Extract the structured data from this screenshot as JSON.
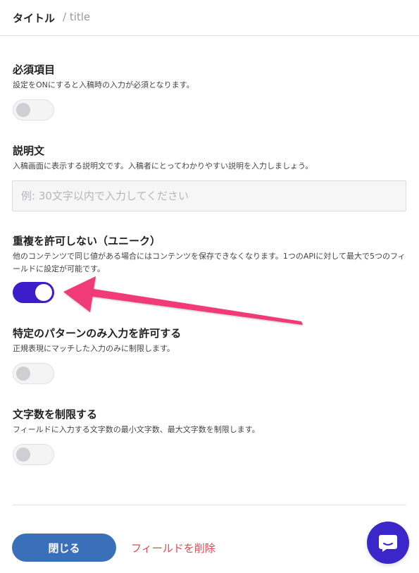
{
  "header": {
    "title": "タイトル",
    "field_id": "/ title"
  },
  "fields": [
    {
      "title": "必須項目",
      "description": "設定をONにすると入稿時の入力が必須となります。",
      "toggle_on": false
    },
    {
      "title": "説明文",
      "description": "入稿画面に表示する説明文です。入稿者にとってわかりやすい説明を入力しましょう。",
      "placeholder": "例: 30文字以内で入力してください",
      "value": ""
    },
    {
      "title": "重複を許可しない（ユニーク）",
      "description": "他のコンテンツで同じ値がある場合にはコンテンツを保存できなくなります。1つのAPIに対して最大で5つのフィールドに設定が可能です。",
      "toggle_on": true
    },
    {
      "title": "特定のパターンのみ入力を許可する",
      "description": "正規表現にマッチした入力のみに制限します。",
      "toggle_on": false
    },
    {
      "title": "文字数を制限する",
      "description": "フィールドに入力する文字数の最小文字数、最大文字数を制限します。",
      "toggle_on": false
    }
  ],
  "footer": {
    "close_label": "閉じる",
    "delete_label": "フィールドを削除"
  },
  "colors": {
    "toggle_on": "#3b1ec9",
    "primary_button": "#3a6fb9",
    "danger_text": "#e5484d",
    "chat_button": "#3b27c9",
    "annotation_arrow": "#f03a78"
  },
  "icons": {
    "chat": "chat-bubble-icon",
    "annotation": "pointer-arrow"
  }
}
